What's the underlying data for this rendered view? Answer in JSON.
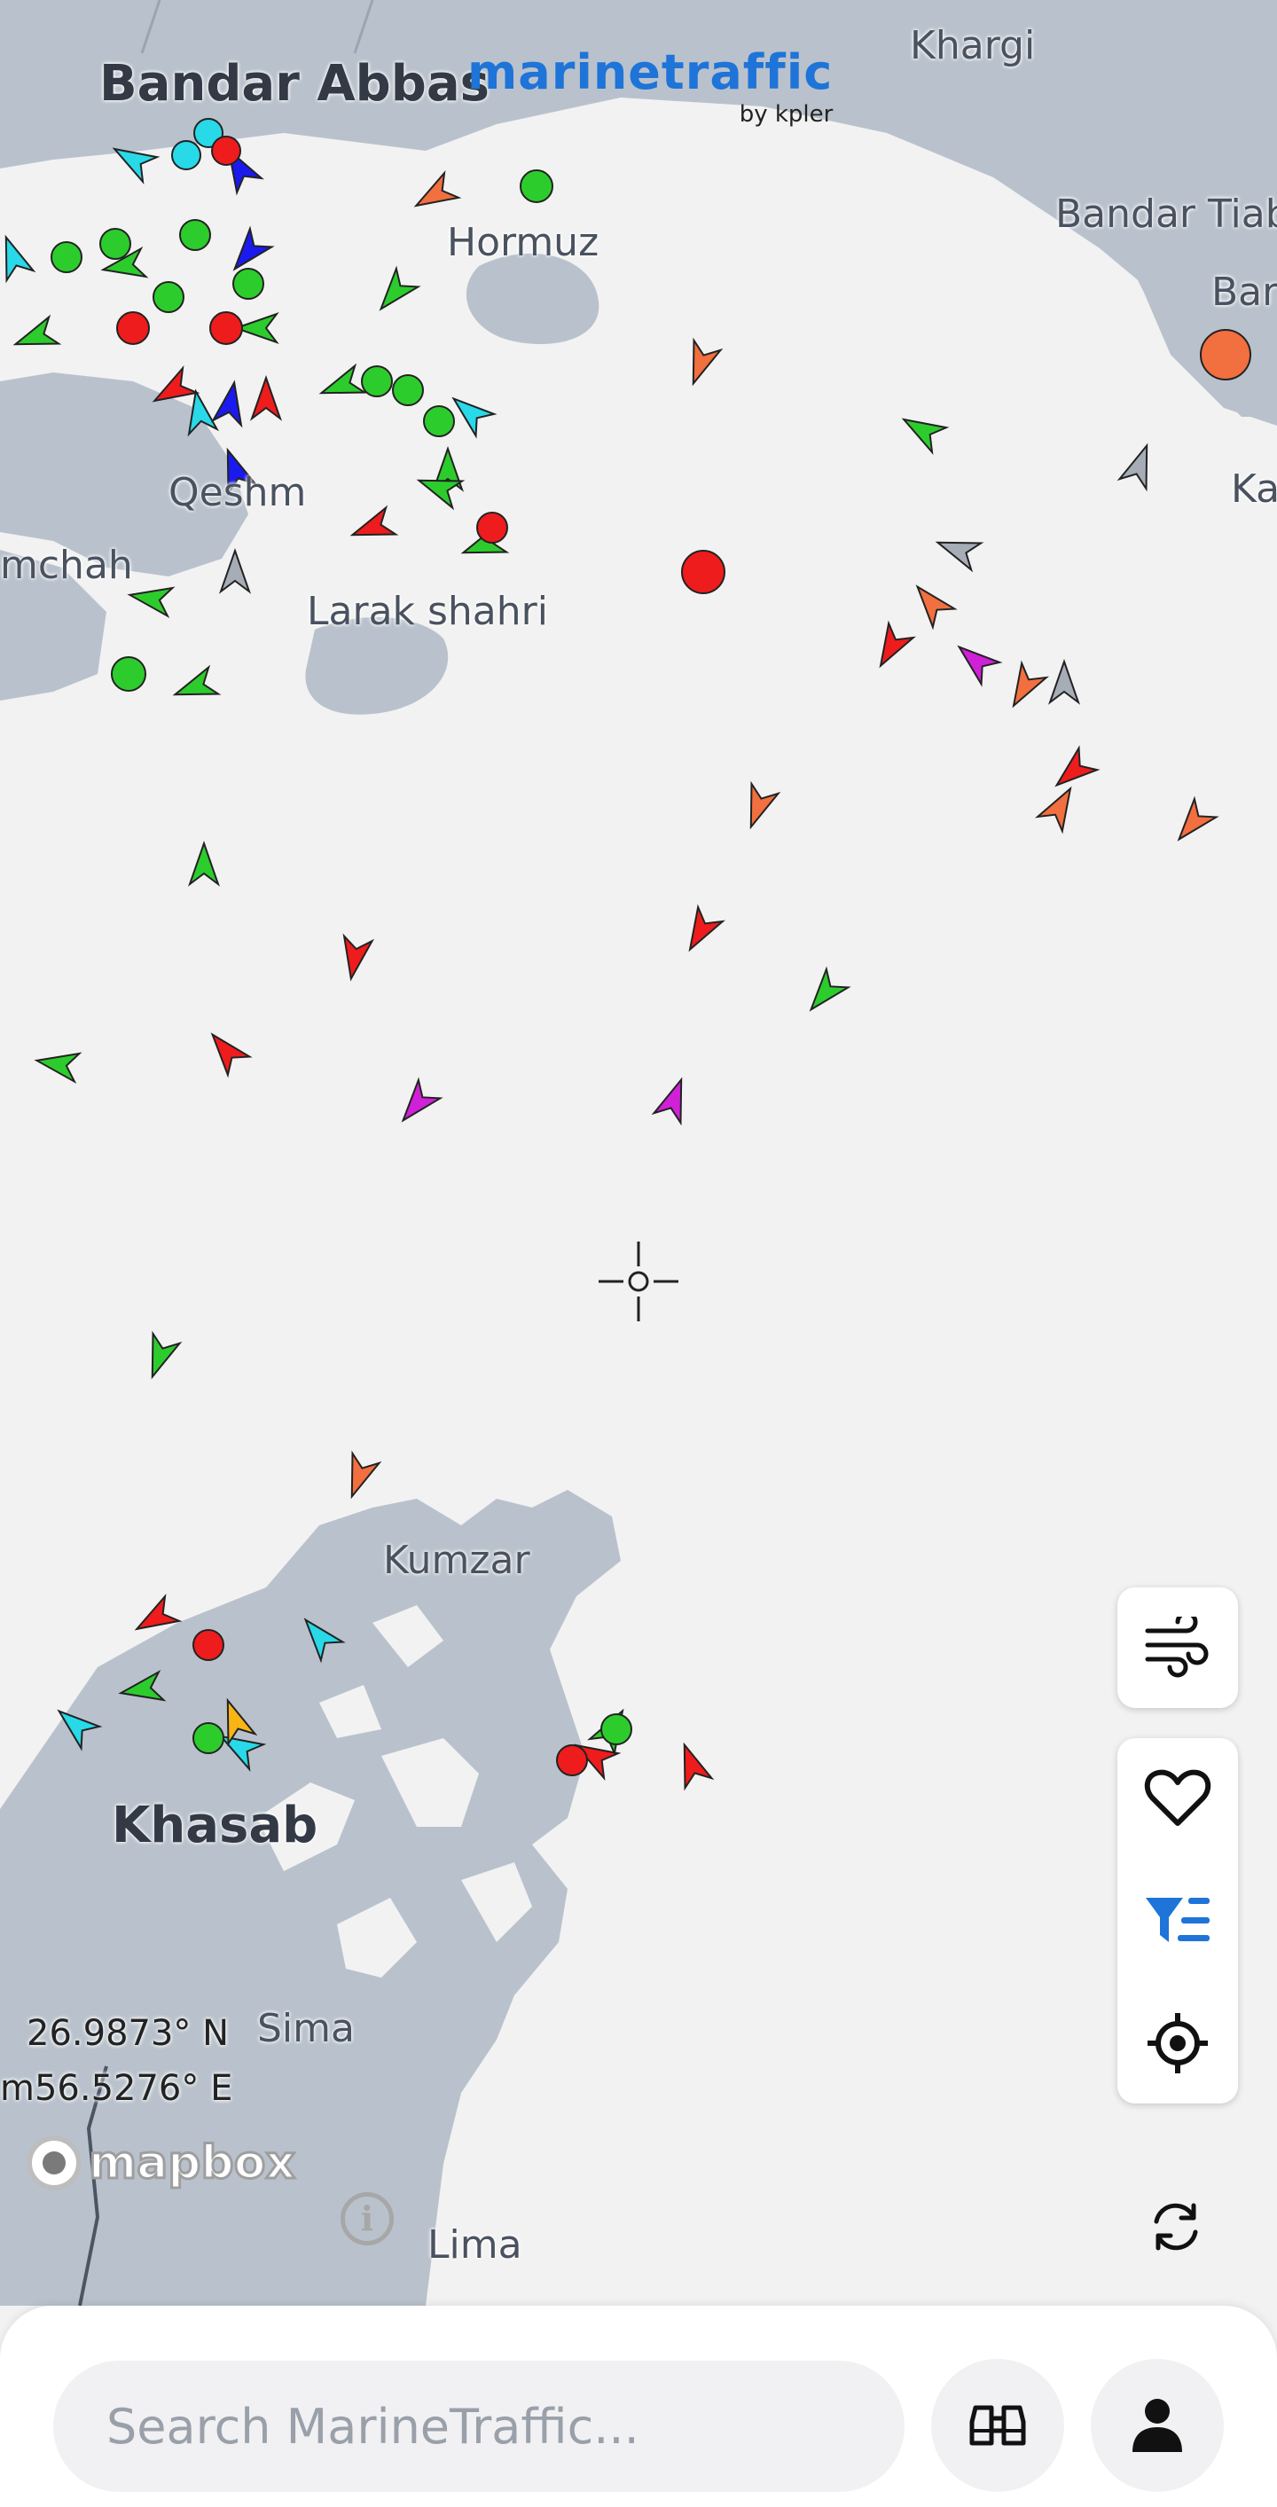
{
  "app": {
    "logo_text": "marinetraffic",
    "logo_byline": "by kpler",
    "brand_color": "#1e74d8"
  },
  "places": {
    "bandar_abbas": "Bandar Abbas",
    "khargi": "Khargi",
    "bandar_tiab": "Bandar Tiab",
    "bar": "Bar",
    "ka": "Ka",
    "hormuz": "Hormuz",
    "qeshm": "Qeshm",
    "mchah": "mchah",
    "larak": "Larak shahri",
    "kumzar": "Kumzar",
    "khasab": "Khasab",
    "sima": "Sima",
    "lima": "Lima"
  },
  "coordinates": {
    "lat": "26.9873° N",
    "lon": "56.5276° E",
    "lon_prefix": "m"
  },
  "attribution": {
    "mapbox": "mapbox",
    "info_symbol": "i"
  },
  "controls": {
    "weather": "wind-icon",
    "favorites": "heart-icon",
    "filters": "filter-icon",
    "locate": "target-icon",
    "refresh": "refresh-icon"
  },
  "search": {
    "placeholder": "Search MarineTraffic..."
  },
  "bottom_actions": {
    "explore": "binoculars-icon",
    "account": "user-icon"
  },
  "vessel_colors": {
    "cargo": "#2dcc2d",
    "tanker": "#ee1c1c",
    "passenger": "#1a1aee",
    "tug_special": "#28d9e8",
    "fishing": "#f26f3f",
    "pleasure": "#d020d8",
    "unknown": "#a6adb7",
    "hsc": "#f9b515"
  }
}
